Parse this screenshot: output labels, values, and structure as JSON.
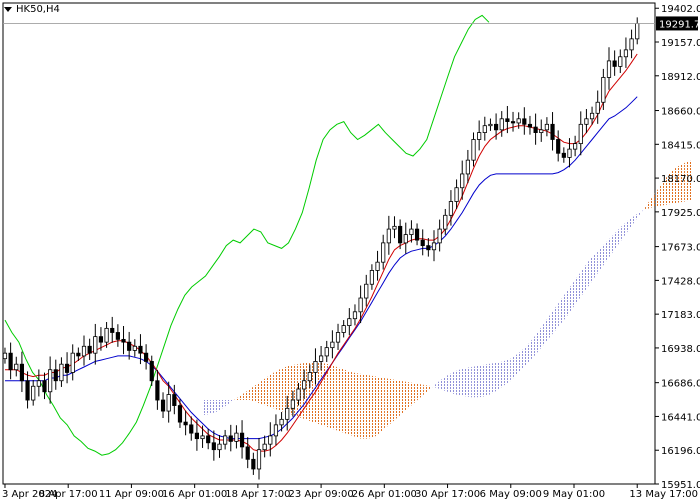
{
  "header": {
    "symbol": "HK50,H4"
  },
  "price_marker": {
    "label": "19291.7"
  },
  "colors": {
    "background": "#ffffff",
    "candle": "#000000",
    "tenkan": "#d00000",
    "kijun": "#0000cc",
    "chikou": "#00cc00",
    "kumo_bull": "#e07020",
    "kumo_bear": "#9090d8",
    "grid_axis": "#000000"
  },
  "chart_data": {
    "type": "candlestick",
    "title": "HK50,H4",
    "ylim": [
      15951,
      19440
    ],
    "y_ticks": [
      "19402.0",
      "19157.0",
      "18912.0",
      "18660.0",
      "18415.0",
      "18170.0",
      "17925.0",
      "17673.0",
      "17428.0",
      "17183.0",
      "16938.0",
      "16686.0",
      "16441.0",
      "16196.0",
      "15951.0"
    ],
    "y_tick_values": [
      19402,
      19157,
      18912,
      18660,
      18415,
      18170,
      17925,
      17673,
      17428,
      17183,
      16938,
      16686,
      16441,
      16196,
      15951
    ],
    "x_labels": [
      "3 Apr 2024",
      "8 Apr 17:00",
      "11 Apr 09:00",
      "16 Apr 01:00",
      "18 Apr 17:00",
      "23 Apr 09:00",
      "26 Apr 01:00",
      "30 Apr 17:00",
      "6 May 09:00",
      "9 May 01:00",
      "13 May 17:00"
    ],
    "x_label_bars": [
      0,
      16,
      32,
      48,
      64,
      80,
      96,
      112,
      128,
      144,
      160
    ],
    "current_price": 19291.7,
    "close": [
      16900,
      16780,
      16820,
      16700,
      16560,
      16660,
      16700,
      16620,
      16780,
      16700,
      16820,
      16760,
      16900,
      16880,
      16950,
      16900,
      17020,
      16980,
      17080,
      17050,
      17000,
      16980,
      16920,
      16950,
      16900,
      16840,
      16700,
      16560,
      16480,
      16600,
      16520,
      16400,
      16380,
      16320,
      16280,
      16300,
      16250,
      16200,
      16240,
      16300,
      16260,
      16320,
      16220,
      16130,
      16060,
      16200,
      16240,
      16300,
      16380,
      16420,
      16500,
      16560,
      16640,
      16700,
      16760,
      16840,
      16880,
      16940,
      16980,
      17050,
      17100,
      17150,
      17200,
      17300,
      17400,
      17500,
      17560,
      17700,
      17800,
      17820,
      17700,
      17760,
      17800,
      17720,
      17680,
      17650,
      17700,
      17800,
      17900,
      18000,
      18100,
      18200,
      18300,
      18450,
      18500,
      18550,
      18560,
      18520,
      18600,
      18580,
      18570,
      18600,
      18560,
      18540,
      18500,
      18520,
      18560,
      18450,
      18350,
      18320,
      18380,
      18420,
      18560,
      18600,
      18640,
      18720,
      18900,
      19020,
      18980,
      19050,
      19100,
      19180,
      19291.7
    ],
    "tenkan": [
      16780,
      16780,
      16780,
      16760,
      16740,
      16730,
      16740,
      16740,
      16760,
      16760,
      16790,
      16800,
      16820,
      16850,
      16880,
      16900,
      16920,
      16940,
      16960,
      16980,
      16990,
      16990,
      16970,
      16950,
      16920,
      16880,
      16830,
      16770,
      16700,
      16660,
      16600,
      16540,
      16480,
      16430,
      16390,
      16350,
      16310,
      16290,
      16270,
      16270,
      16270,
      16270,
      16260,
      16240,
      16200,
      16190,
      16190,
      16200,
      16230,
      16270,
      16320,
      16380,
      16440,
      16500,
      16560,
      16620,
      16690,
      16760,
      16830,
      16900,
      16960,
      17020,
      17080,
      17150,
      17230,
      17310,
      17400,
      17490,
      17580,
      17650,
      17680,
      17700,
      17720,
      17730,
      17730,
      17720,
      17720,
      17750,
      17800,
      17870,
      17950,
      18040,
      18140,
      18240,
      18330,
      18400,
      18450,
      18480,
      18510,
      18530,
      18540,
      18550,
      18550,
      18540,
      18530,
      18520,
      18510,
      18490,
      18460,
      18430,
      18420,
      18420,
      18450,
      18500,
      18560,
      18630,
      18720,
      18800,
      18850,
      18900,
      18950,
      19010,
      19070
    ],
    "kijun": [
      16700,
      16700,
      16700,
      16700,
      16700,
      16700,
      16700,
      16700,
      16720,
      16720,
      16740,
      16740,
      16760,
      16780,
      16800,
      16820,
      16840,
      16850,
      16860,
      16870,
      16880,
      16880,
      16880,
      16870,
      16860,
      16840,
      16810,
      16770,
      16720,
      16670,
      16620,
      16570,
      16520,
      16470,
      16430,
      16390,
      16350,
      16320,
      16300,
      16290,
      16280,
      16280,
      16280,
      16280,
      16280,
      16280,
      16290,
      16300,
      16320,
      16350,
      16390,
      16430,
      16480,
      16530,
      16590,
      16650,
      16710,
      16770,
      16830,
      16890,
      16950,
      17010,
      17070,
      17130,
      17200,
      17270,
      17340,
      17410,
      17480,
      17540,
      17590,
      17620,
      17640,
      17650,
      17660,
      17660,
      17680,
      17710,
      17750,
      17800,
      17860,
      17920,
      17990,
      18060,
      18120,
      18160,
      18190,
      18200,
      18200,
      18200,
      18200,
      18200,
      18200,
      18200,
      18200,
      18200,
      18200,
      18200,
      18210,
      18230,
      18260,
      18300,
      18350,
      18400,
      18450,
      18500,
      18550,
      18600,
      18620,
      18650,
      18680,
      18720,
      18760
    ],
    "chikou": [
      17140,
      17050,
      16980,
      16860,
      16760,
      16700,
      16600,
      16520,
      16430,
      16380,
      16300,
      16260,
      16210,
      16190,
      16160,
      16170,
      16200,
      16250,
      16320,
      16400,
      16520,
      16650,
      16800,
      16950,
      17100,
      17220,
      17320,
      17380,
      17420,
      17460,
      17530,
      17600,
      17680,
      17720,
      17700,
      17750,
      17800,
      17780,
      17700,
      17680,
      17660,
      17700,
      17800,
      17920,
      18100,
      18300,
      18450,
      18520,
      18560,
      18580,
      18500,
      18450,
      18480,
      18520,
      18560,
      18500,
      18450,
      18400,
      18350,
      18330,
      18380,
      18450,
      18600,
      18750,
      18900,
      19050,
      19150,
      19250,
      19320,
      19350,
      19300
    ],
    "senkou_a": [
      16450,
      16460,
      16480,
      16520,
      16560,
      16600,
      16640,
      16680,
      16720,
      16760,
      16790,
      16810,
      16820,
      16830,
      16830,
      16830,
      16820,
      16800,
      16780,
      16760,
      16750,
      16740,
      16730,
      16720,
      16710,
      16700,
      16690,
      16680,
      16670,
      16660,
      16640,
      16620,
      16600,
      16590,
      16580,
      16580,
      16590,
      16620,
      16660,
      16700,
      16760,
      16820,
      16880,
      16950,
      17020,
      17090,
      17160,
      17240,
      17320,
      17400,
      17480,
      17560,
      17640,
      17720,
      17800,
      17880,
      17960,
      18040,
      18120,
      18200,
      18250,
      18280,
      18300
    ],
    "senkou_b": [
      16560,
      16560,
      16560,
      16560,
      16560,
      16560,
      16560,
      16540,
      16520,
      16500,
      16480,
      16460,
      16440,
      16420,
      16400,
      16380,
      16360,
      16340,
      16320,
      16300,
      16280,
      16280,
      16300,
      16350,
      16400,
      16450,
      16500,
      16550,
      16600,
      16650,
      16700,
      16740,
      16770,
      16790,
      16800,
      16810,
      16820,
      16830,
      16840,
      16860,
      16900,
      16950,
      17020,
      17100,
      17180,
      17260,
      17340,
      17420,
      17500,
      17580,
      17640,
      17700,
      17760,
      17820,
      17870,
      17910,
      17940,
      17960,
      17970,
      17980,
      17990,
      18000,
      18010
    ]
  }
}
